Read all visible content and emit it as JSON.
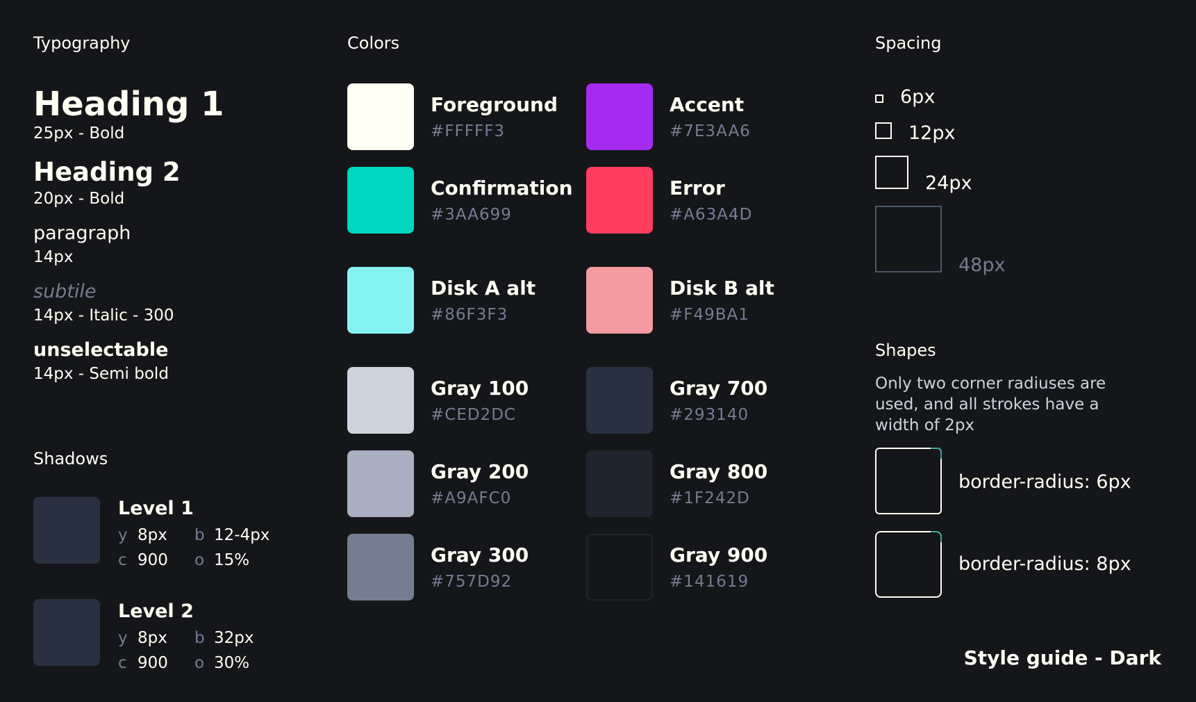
{
  "typography": {
    "title": "Typography",
    "items": [
      {
        "sample": "Heading 1",
        "spec": "25px - Bold"
      },
      {
        "sample": "Heading 2",
        "spec": "20px - Bold"
      },
      {
        "sample": "paragraph",
        "spec": "14px"
      },
      {
        "sample": "subtile",
        "spec": "14px - Italic - 300"
      },
      {
        "sample": "unselectable",
        "spec": "14px - Semi bold"
      }
    ]
  },
  "shadows": {
    "title": "Shadows",
    "levels": [
      {
        "name": "Level 1",
        "y_key": "y",
        "y_val": "8px",
        "b_key": "b",
        "b_val": "12-4px",
        "c_key": "c",
        "c_val": "900",
        "o_key": "o",
        "o_val": "15%"
      },
      {
        "name": "Level 2",
        "y_key": "y",
        "y_val": "8px",
        "b_key": "b",
        "b_val": "32px",
        "c_key": "c",
        "c_val": "900",
        "o_key": "o",
        "o_val": "30%"
      }
    ]
  },
  "colors": {
    "title": "Colors",
    "items": [
      {
        "name": "Foreground",
        "hex": "#FFFFF3",
        "swatch": "#FFFFF3"
      },
      {
        "name": "Accent",
        "hex": "#7E3AA6",
        "swatch": "#A62BF0"
      },
      {
        "name": "Confirmation",
        "hex": "#3AA699",
        "swatch": "#00D6C0"
      },
      {
        "name": "Error",
        "hex": "#A63A4D",
        "swatch": "#FF3D5E"
      },
      {
        "name": "Disk A alt",
        "hex": "#86F3F3",
        "swatch": "#86F3F3"
      },
      {
        "name": "Disk B alt",
        "hex": "#F49BA1",
        "swatch": "#F49BA1"
      },
      {
        "name": "Gray 100",
        "hex": "#CED2DC",
        "swatch": "#CED2DC"
      },
      {
        "name": "Gray 700",
        "hex": "#293140",
        "swatch": "#293140"
      },
      {
        "name": "Gray 200",
        "hex": "#A9AFC0",
        "swatch": "#A9AFC0"
      },
      {
        "name": "Gray 800",
        "hex": "#1F242D",
        "swatch": "#1F242D"
      },
      {
        "name": "Gray 300",
        "hex": "#757D92",
        "swatch": "#757D92"
      },
      {
        "name": "Gray 900",
        "hex": "#141619",
        "swatch": "#141619"
      }
    ]
  },
  "spacing": {
    "title": "Spacing",
    "items": [
      "6px",
      "12px",
      "24px",
      "48px"
    ]
  },
  "shapes": {
    "title": "Shapes",
    "description": "Only two corner radiuses are used, and all strokes have a width of 2px",
    "items": [
      "border-radius: 6px",
      "border-radius: 8px"
    ]
  },
  "footer": "Style guide - Dark"
}
